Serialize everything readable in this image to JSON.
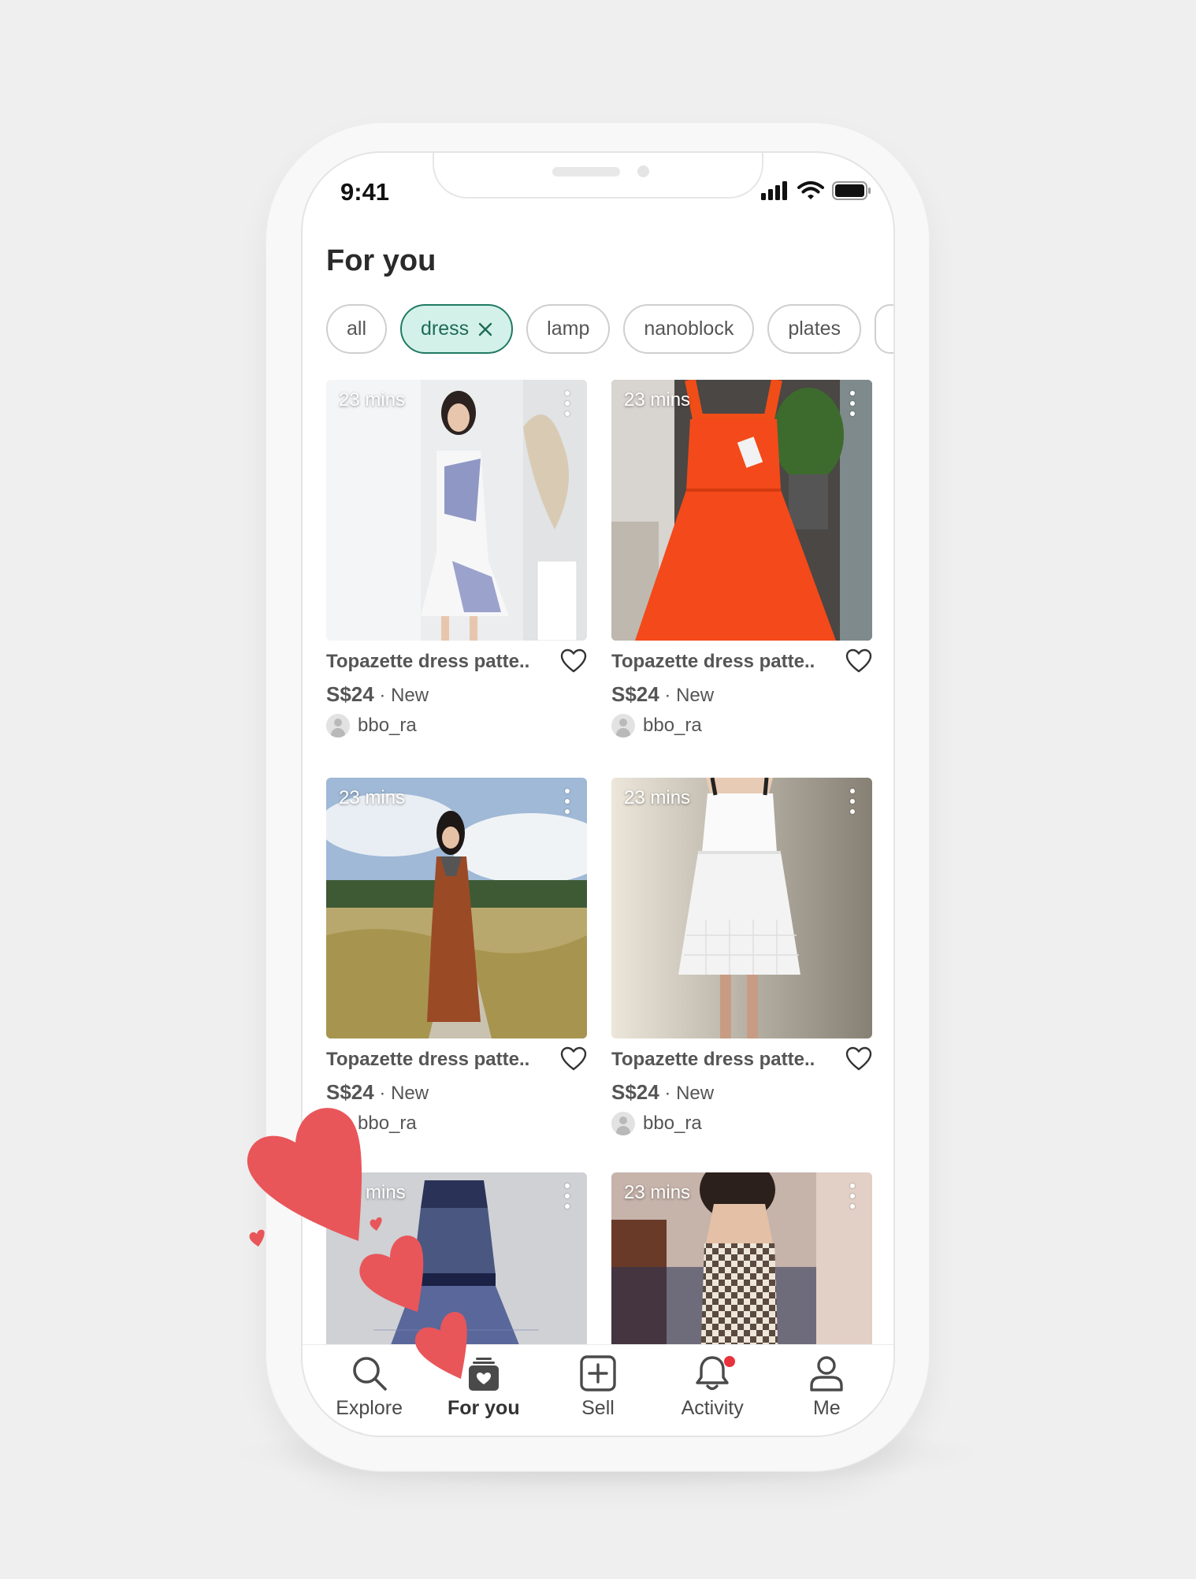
{
  "status_bar": {
    "time": "9:41"
  },
  "page": {
    "title": "For you"
  },
  "filters": [
    {
      "label": "all",
      "active": false
    },
    {
      "label": "dress",
      "active": true
    },
    {
      "label": "lamp",
      "active": false
    },
    {
      "label": "nanoblock",
      "active": false
    },
    {
      "label": "plates",
      "active": false
    }
  ],
  "listings": [
    {
      "time": "23 mins",
      "title": "Topazette dress patte..",
      "price": "S$24",
      "condition": "· New",
      "seller": "bbo_ra"
    },
    {
      "time": "23 mins",
      "title": "Topazette dress patte..",
      "price": "S$24",
      "condition": "· New",
      "seller": "bbo_ra"
    },
    {
      "time": "23 mins",
      "title": "Topazette dress patte..",
      "price": "S$24",
      "condition": "· New",
      "seller": "bbo_ra"
    },
    {
      "time": "23 mins",
      "title": "Topazette dress patte..",
      "price": "S$24",
      "condition": "· New",
      "seller": "bbo_ra"
    },
    {
      "time": "mins",
      "title": "",
      "price": "",
      "condition": "",
      "seller": ""
    },
    {
      "time": "23 mins",
      "title": "",
      "price": "",
      "condition": "",
      "seller": ""
    }
  ],
  "tabs": [
    {
      "label": "Explore",
      "icon": "search-icon"
    },
    {
      "label": "For you",
      "icon": "for-you-icon",
      "active": true
    },
    {
      "label": "Sell",
      "icon": "plus-square-icon"
    },
    {
      "label": "Activity",
      "icon": "bell-icon",
      "badge": true
    },
    {
      "label": "Me",
      "icon": "person-icon"
    }
  ],
  "colors": {
    "accent": "#1f7a62",
    "accent_bg": "#d3f1e9",
    "heart": "#e8565a",
    "badge": "#e8323c"
  }
}
